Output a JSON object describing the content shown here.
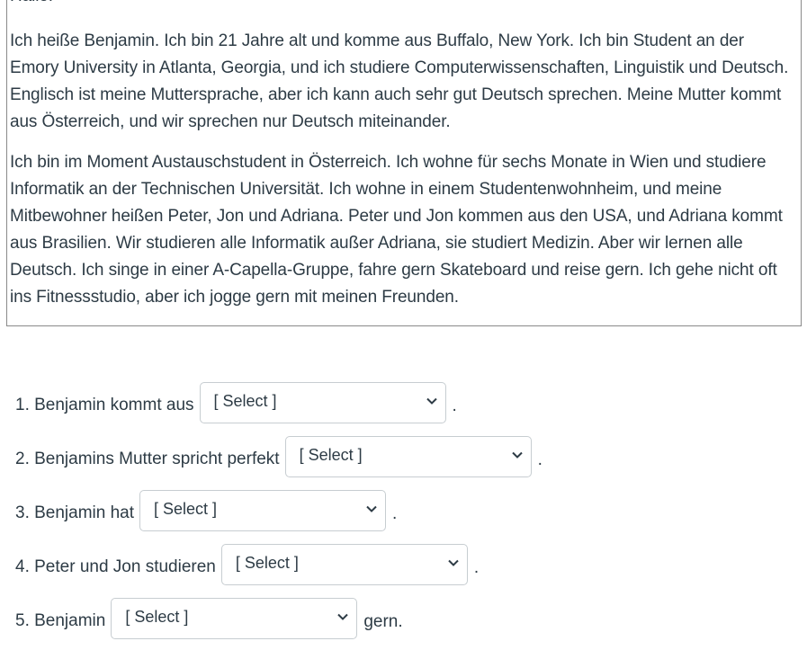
{
  "passage": {
    "greeting": "Hallo!",
    "paragraphs": [
      "Ich heiße Benjamin. Ich bin 21 Jahre alt und komme aus Buffalo, New York. Ich bin Student an der Emory University in Atlanta, Georgia, und ich studiere Computerwissenschaften, Linguistik und Deutsch. Englisch ist meine Muttersprache, aber ich kann auch sehr gut Deutsch sprechen. Meine Mutter kommt aus Österreich, und wir sprechen nur Deutsch miteinander.",
      "Ich bin im Moment Austauschstudent in Österreich. Ich wohne für sechs Monate in Wien und studiere Informatik an der Technischen Universität. Ich wohne in einem Studentenwohnheim, und meine Mitbewohner heißen Peter, Jon und Adriana. Peter und Jon kommen aus den USA, und Adriana kommt aus Brasilien. Wir studieren alle Informatik außer Adriana, sie studiert Medizin. Aber wir lernen alle Deutsch. Ich singe in einer A-Capella-Gruppe, fahre gern Skateboard und reise gern. Ich gehe nicht oft ins Fitnessstudio, aber ich jogge gern mit meinen Freunden."
    ]
  },
  "questions": [
    {
      "label": "1. Benjamin kommt aus",
      "selected": "[ Select ]",
      "suffix": "."
    },
    {
      "label": "2. Benjamins Mutter spricht perfekt",
      "selected": "[ Select ]",
      "suffix": "."
    },
    {
      "label": "3. Benjamin hat",
      "selected": "[ Select ]",
      "suffix": "."
    },
    {
      "label": "4. Peter und Jon studieren",
      "selected": "[ Select ]",
      "suffix": "."
    },
    {
      "label": "5. Benjamin",
      "selected": "[ Select ]",
      "suffix": "gern."
    }
  ]
}
